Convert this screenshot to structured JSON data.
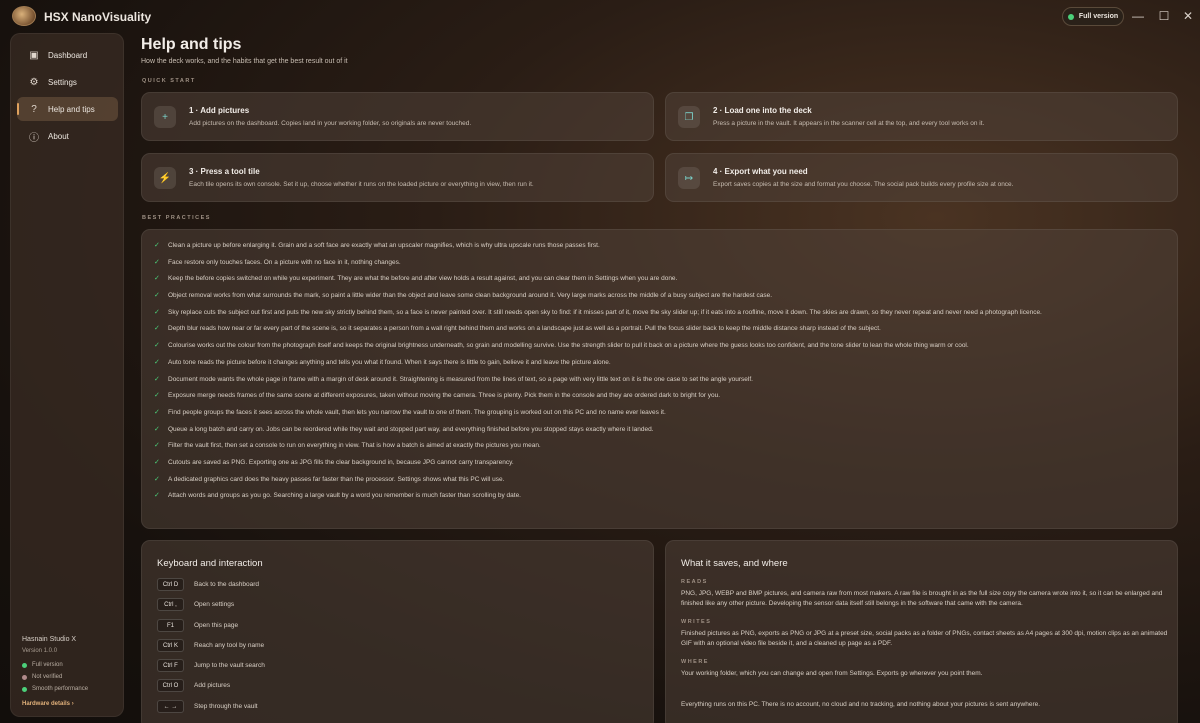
{
  "app": {
    "title": "HSX NanoVisuality",
    "version_badge": "Full version",
    "window_controls": [
      "minimize-icon",
      "maximize-icon",
      "close-icon"
    ],
    "accent": "#e0a25e",
    "ok_color": "#4bd07a"
  },
  "sidebar": {
    "items": [
      {
        "label": "Dashboard",
        "icon": "dashboard-icon"
      },
      {
        "label": "Settings",
        "icon": "gear-icon"
      },
      {
        "label": "Help and tips",
        "icon": "question-icon",
        "active": true
      },
      {
        "label": "About",
        "icon": "info-icon"
      }
    ],
    "studio": "Hasnain Studio X",
    "version": "Version 1.0.0",
    "statuses": [
      {
        "label": "Full version",
        "color": "#4bd07a"
      },
      {
        "label": "Not verified",
        "color": "#b08a8a"
      },
      {
        "label": "Smooth performance",
        "color": "#4bd07a"
      }
    ],
    "hardware_link": "Hardware details ›"
  },
  "page": {
    "title": "Help and tips",
    "subtitle": "How the deck works, and the habits that get the best result out of it"
  },
  "quick_start": {
    "label": "QUICK START",
    "steps": [
      {
        "title": "1 · Add pictures",
        "desc": "Add pictures on the dashboard. Copies land in your working folder, so originals are never touched.",
        "icon": "plus-icon"
      },
      {
        "title": "2 · Load one into the deck",
        "desc": "Press a picture in the vault. It appears in the scanner cell at the top, and every tool works on it.",
        "icon": "layers-icon"
      },
      {
        "title": "3 · Press a tool tile",
        "desc": "Each tile opens its own console. Set it up, choose whether it runs on the loaded picture or everything in view, then run it.",
        "icon": "bolt-icon"
      },
      {
        "title": "4 · Export what you need",
        "desc": "Export saves copies at the size and format you choose. The social pack builds every profile size at once.",
        "icon": "export-icon"
      }
    ]
  },
  "best_practices": {
    "label": "BEST PRACTICES",
    "items": [
      "Clean a picture up before enlarging it. Grain and a soft face are exactly what an upscaler magnifies, which is why ultra upscale runs those passes first.",
      "Face restore only touches faces. On a picture with no face in it, nothing changes.",
      "Keep the before copies switched on while you experiment. They are what the before and after view holds a result against, and you can clear them in Settings when you are done.",
      "Object removal works from what surrounds the mark, so paint a little wider than the object and leave some clean background around it. Very large marks across the middle of a busy subject are the hardest case.",
      "Sky replace cuts the subject out first and puts the new sky strictly behind them, so a face is never painted over. It still needs open sky to find: if it misses part of it, move the sky slider up; if it eats into a roofline, move it down. The skies are drawn, so they never repeat and never need a photograph licence.",
      "Depth blur reads how near or far every part of the scene is, so it separates a person from a wall right behind them and works on a landscape just as well as a portrait. Pull the focus slider back to keep the middle distance sharp instead of the subject.",
      "Colourise works out the colour from the photograph itself and keeps the original brightness underneath, so grain and modelling survive. Use the strength slider to pull it back on a picture where the guess looks too confident, and the tone slider to lean the whole thing warm or cool.",
      "Auto tone reads the picture before it changes anything and tells you what it found. When it says there is little to gain, believe it and leave the picture alone.",
      "Document mode wants the whole page in frame with a margin of desk around it. Straightening is measured from the lines of text, so a page with very little text on it is the one case to set the angle yourself.",
      "Exposure merge needs frames of the same scene at different exposures, taken without moving the camera. Three is plenty. Pick them in the console and they are ordered dark to bright for you.",
      "Find people groups the faces it sees across the whole vault, then lets you narrow the vault to one of them. The grouping is worked out on this PC and no name ever leaves it.",
      "Queue a long batch and carry on. Jobs can be reordered while they wait and stopped part way, and everything finished before you stopped stays exactly where it landed.",
      "Filter the vault first, then set a console to run on everything in view. That is how a batch is aimed at exactly the pictures you mean.",
      "Cutouts are saved as PNG. Exporting one as JPG fills the clear background in, because JPG cannot carry transparency.",
      "A dedicated graphics card does the heavy passes far faster than the processor. Settings shows what this PC will use.",
      "Attach words and groups as you go. Searching a large vault by a word you remember is much faster than scrolling by date."
    ]
  },
  "keyboard": {
    "title": "Keyboard and interaction",
    "shortcuts": [
      {
        "key": "Ctrl D",
        "desc": "Back to the dashboard"
      },
      {
        "key": "Ctrl ,",
        "desc": "Open settings"
      },
      {
        "key": "F1",
        "desc": "Open this page"
      },
      {
        "key": "Ctrl K",
        "desc": "Reach any tool by name"
      },
      {
        "key": "Ctrl F",
        "desc": "Jump to the vault search"
      },
      {
        "key": "Ctrl O",
        "desc": "Add pictures"
      },
      {
        "key": "← →",
        "desc": "Step through the vault"
      }
    ]
  },
  "saves": {
    "title": "What it saves, and where",
    "reads_label": "READS",
    "reads": "PNG, JPG, WEBP and BMP pictures, and camera raw from most makers. A raw file is brought in as the full size copy the camera wrote into it, so it can be enlarged and finished like any other picture. Developing the sensor data itself still belongs in the software that came with the camera.",
    "writes_label": "WRITES",
    "writes": "Finished pictures as PNG, exports as PNG or JPG at a preset size, social packs as a folder of PNGs, contact sheets as A4 pages at 300 dpi, motion clips as an animated GIF with an optional video file beside it, and a cleaned up page as a PDF.",
    "where_label": "WHERE",
    "where": "Your working folder, which you can change and open from Settings. Exports go wherever you point them.",
    "privacy": "Everything runs on this PC. There is no account, no cloud and no tracking, and nothing about your pictures is sent anywhere."
  }
}
